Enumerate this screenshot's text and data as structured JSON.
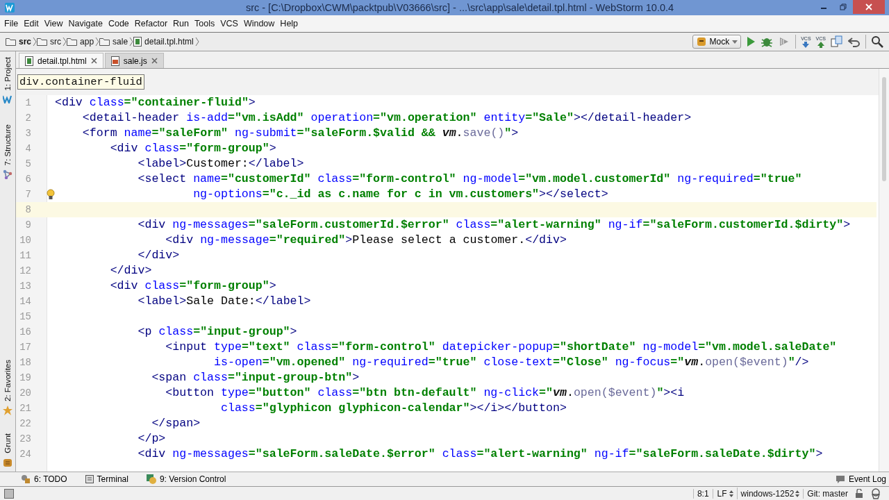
{
  "window": {
    "title": "src - [C:\\Dropbox\\CWM\\packtpub\\V03666\\src] - ...\\src\\app\\sale\\detail.tpl.html - WebStorm 10.0.4"
  },
  "menu": [
    "File",
    "Edit",
    "View",
    "Navigate",
    "Code",
    "Refactor",
    "Run",
    "Tools",
    "VCS",
    "Window",
    "Help"
  ],
  "breadcrumbs": [
    {
      "label": "src",
      "kind": "project"
    },
    {
      "label": "src",
      "kind": "folder"
    },
    {
      "label": "app",
      "kind": "folder"
    },
    {
      "label": "sale",
      "kind": "folder"
    },
    {
      "label": "detail.tpl.html",
      "kind": "file"
    }
  ],
  "toolbar": {
    "run_config": "Mock",
    "vcs_update": "VCS",
    "vcs_commit": "VCS"
  },
  "tabs": [
    {
      "label": "detail.tpl.html",
      "kind": "html",
      "selected": true
    },
    {
      "label": "sale.js",
      "kind": "js",
      "selected": false
    }
  ],
  "side_tools": {
    "top": [
      "1: Project",
      "7: Structure"
    ],
    "bottom": [
      "2: Favorites",
      "Grunt"
    ]
  },
  "editor": {
    "breadcrumb": "div.container-fluid",
    "lines": [
      {
        "number": "1",
        "current": false,
        "bulb": false,
        "tokens": [
          {
            "kind": "tag",
            "text": "<div"
          },
          {
            "kind": "attr",
            "text": " class"
          },
          {
            "kind": "value",
            "text": "=\"container-fluid\""
          },
          {
            "kind": "tag",
            "text": ">"
          }
        ]
      },
      {
        "number": "2",
        "current": false,
        "bulb": false,
        "tokens": [
          {
            "kind": "tag",
            "text": "    <detail-header"
          },
          {
            "kind": "attr",
            "text": " is-add"
          },
          {
            "kind": "value",
            "text": "=\"vm.isAdd\""
          },
          {
            "kind": "attr",
            "text": " operation"
          },
          {
            "kind": "value",
            "text": "=\"vm.operation\""
          },
          {
            "kind": "attr",
            "text": " entity"
          },
          {
            "kind": "value",
            "text": "=\"Sale\""
          },
          {
            "kind": "tag",
            "text": "></detail-header>"
          }
        ]
      },
      {
        "number": "3",
        "current": false,
        "bulb": false,
        "tokens": [
          {
            "kind": "tag",
            "text": "    <form"
          },
          {
            "kind": "attr",
            "text": " name"
          },
          {
            "kind": "value",
            "text": "=\"saleForm\""
          },
          {
            "kind": "attr",
            "text": " ng-submit"
          },
          {
            "kind": "value",
            "text": "=\"saleForm.$valid && "
          },
          {
            "kind": "variable",
            "text": "vm"
          },
          {
            "kind": "text",
            "text": "."
          },
          {
            "kind": "method",
            "text": "save()"
          },
          {
            "kind": "value",
            "text": "\""
          },
          {
            "kind": "tag",
            "text": ">"
          }
        ]
      },
      {
        "number": "4",
        "current": false,
        "bulb": false,
        "tokens": [
          {
            "kind": "tag",
            "text": "        <div"
          },
          {
            "kind": "attr",
            "text": " class"
          },
          {
            "kind": "value",
            "text": "=\"form-group\""
          },
          {
            "kind": "tag",
            "text": ">"
          }
        ]
      },
      {
        "number": "5",
        "current": false,
        "bulb": false,
        "tokens": [
          {
            "kind": "tag",
            "text": "            <label>"
          },
          {
            "kind": "text",
            "text": "Customer:"
          },
          {
            "kind": "tag",
            "text": "</label>"
          }
        ]
      },
      {
        "number": "6",
        "current": false,
        "bulb": false,
        "tokens": [
          {
            "kind": "tag",
            "text": "            <select"
          },
          {
            "kind": "attr",
            "text": " name"
          },
          {
            "kind": "value",
            "text": "=\"customerId\""
          },
          {
            "kind": "attr",
            "text": " class"
          },
          {
            "kind": "value",
            "text": "=\"form-control\""
          },
          {
            "kind": "attr",
            "text": " ng-model"
          },
          {
            "kind": "value",
            "text": "=\"vm.model.customerId\""
          },
          {
            "kind": "attr",
            "text": " ng-required"
          },
          {
            "kind": "value",
            "text": "=\"true\""
          }
        ]
      },
      {
        "number": "7",
        "current": false,
        "bulb": true,
        "tokens": [
          {
            "kind": "attr",
            "text": "                    ng-options"
          },
          {
            "kind": "value",
            "text": "=\"c._id as c.name for c in vm.customers\""
          },
          {
            "kind": "tag",
            "text": "></select>"
          }
        ]
      },
      {
        "number": "8",
        "current": true,
        "bulb": false
      },
      {
        "number": "9",
        "current": false,
        "bulb": false,
        "tokens": [
          {
            "kind": "tag",
            "text": "            <div"
          },
          {
            "kind": "attr",
            "text": " ng-messages"
          },
          {
            "kind": "value",
            "text": "=\"saleForm.customerId.$error\""
          },
          {
            "kind": "attr",
            "text": " class"
          },
          {
            "kind": "value",
            "text": "=\"alert-warning\""
          },
          {
            "kind": "attr",
            "text": " ng-if"
          },
          {
            "kind": "value",
            "text": "=\"saleForm.customerId.$dirty\""
          },
          {
            "kind": "tag",
            "text": ">"
          }
        ]
      },
      {
        "number": "10",
        "current": false,
        "bulb": false,
        "tokens": [
          {
            "kind": "tag",
            "text": "                <div"
          },
          {
            "kind": "attr",
            "text": " ng-message"
          },
          {
            "kind": "value",
            "text": "=\"required\""
          },
          {
            "kind": "tag",
            "text": ">"
          },
          {
            "kind": "text",
            "text": "Please select a customer."
          },
          {
            "kind": "tag",
            "text": "</div>"
          }
        ]
      },
      {
        "number": "11",
        "current": false,
        "bulb": false,
        "tokens": [
          {
            "kind": "tag",
            "text": "            </div>"
          }
        ]
      },
      {
        "number": "12",
        "current": false,
        "bulb": false,
        "tokens": [
          {
            "kind": "tag",
            "text": "        </div>"
          }
        ]
      },
      {
        "number": "13",
        "current": false,
        "bulb": false,
        "tokens": [
          {
            "kind": "tag",
            "text": "        <div"
          },
          {
            "kind": "attr",
            "text": " class"
          },
          {
            "kind": "value",
            "text": "=\"form-group\""
          },
          {
            "kind": "tag",
            "text": ">"
          }
        ]
      },
      {
        "number": "14",
        "current": false,
        "bulb": false,
        "tokens": [
          {
            "kind": "tag",
            "text": "            <label>"
          },
          {
            "kind": "text",
            "text": "Sale Date:"
          },
          {
            "kind": "tag",
            "text": "</label>"
          }
        ]
      },
      {
        "number": "15",
        "current": false,
        "bulb": false
      },
      {
        "number": "16",
        "current": false,
        "bulb": false,
        "tokens": [
          {
            "kind": "tag",
            "text": "            <p"
          },
          {
            "kind": "attr",
            "text": " class"
          },
          {
            "kind": "value",
            "text": "=\"input-group\""
          },
          {
            "kind": "tag",
            "text": ">"
          }
        ]
      },
      {
        "number": "17",
        "current": false,
        "bulb": false,
        "tokens": [
          {
            "kind": "tag",
            "text": "                <input"
          },
          {
            "kind": "attr",
            "text": " type"
          },
          {
            "kind": "value",
            "text": "=\"text\""
          },
          {
            "kind": "attr",
            "text": " class"
          },
          {
            "kind": "value",
            "text": "=\"form-control\""
          },
          {
            "kind": "attr",
            "text": " datepicker-popup"
          },
          {
            "kind": "value",
            "text": "=\"shortDate\""
          },
          {
            "kind": "attr",
            "text": " ng-model"
          },
          {
            "kind": "value",
            "text": "=\"vm.model.saleDate\""
          }
        ]
      },
      {
        "number": "18",
        "current": false,
        "bulb": false,
        "tokens": [
          {
            "kind": "attr",
            "text": "                       is-open"
          },
          {
            "kind": "value",
            "text": "=\"vm.opened\""
          },
          {
            "kind": "attr",
            "text": " ng-required"
          },
          {
            "kind": "value",
            "text": "=\"true\""
          },
          {
            "kind": "attr",
            "text": " close-text"
          },
          {
            "kind": "value",
            "text": "=\"Close\""
          },
          {
            "kind": "attr",
            "text": " ng-focus"
          },
          {
            "kind": "value",
            "text": "=\""
          },
          {
            "kind": "variable",
            "text": "vm"
          },
          {
            "kind": "text",
            "text": "."
          },
          {
            "kind": "method",
            "text": "open($event)"
          },
          {
            "kind": "value",
            "text": "\""
          },
          {
            "kind": "tag",
            "text": "/>"
          }
        ]
      },
      {
        "number": "19",
        "current": false,
        "bulb": false,
        "tokens": [
          {
            "kind": "tag",
            "text": "              <span"
          },
          {
            "kind": "attr",
            "text": " class"
          },
          {
            "kind": "value",
            "text": "=\"input-group-btn\""
          },
          {
            "kind": "tag",
            "text": ">"
          }
        ]
      },
      {
        "number": "20",
        "current": false,
        "bulb": false,
        "tokens": [
          {
            "kind": "tag",
            "text": "                <button"
          },
          {
            "kind": "attr",
            "text": " type"
          },
          {
            "kind": "value",
            "text": "=\"button\""
          },
          {
            "kind": "attr",
            "text": " class"
          },
          {
            "kind": "value",
            "text": "=\"btn btn-default\""
          },
          {
            "kind": "attr",
            "text": " ng-click"
          },
          {
            "kind": "value",
            "text": "=\""
          },
          {
            "kind": "variable",
            "text": "vm"
          },
          {
            "kind": "text",
            "text": "."
          },
          {
            "kind": "method",
            "text": "open($event)"
          },
          {
            "kind": "value",
            "text": "\""
          },
          {
            "kind": "tag",
            "text": "><i"
          }
        ]
      },
      {
        "number": "21",
        "current": false,
        "bulb": false,
        "tokens": [
          {
            "kind": "attr",
            "text": "                        class"
          },
          {
            "kind": "value",
            "text": "=\"glyphicon glyphicon-calendar\""
          },
          {
            "kind": "tag",
            "text": "></i></button>"
          }
        ]
      },
      {
        "number": "22",
        "current": false,
        "bulb": false,
        "tokens": [
          {
            "kind": "tag",
            "text": "              </span>"
          }
        ]
      },
      {
        "number": "23",
        "current": false,
        "bulb": false,
        "tokens": [
          {
            "kind": "tag",
            "text": "            </p>"
          }
        ]
      },
      {
        "number": "24",
        "current": false,
        "bulb": false,
        "tokens": [
          {
            "kind": "tag",
            "text": "            <div"
          },
          {
            "kind": "attr",
            "text": " ng-messages"
          },
          {
            "kind": "value",
            "text": "=\"saleForm.saleDate.$error\""
          },
          {
            "kind": "attr",
            "text": " class"
          },
          {
            "kind": "value",
            "text": "=\"alert-warning\""
          },
          {
            "kind": "attr",
            "text": " ng-if"
          },
          {
            "kind": "value",
            "text": "=\"saleForm.saleDate.$dirty\""
          },
          {
            "kind": "tag",
            "text": ">"
          }
        ]
      }
    ]
  },
  "tool_windows": [
    {
      "label": "6: TODO",
      "kind": "todo"
    },
    {
      "label": "Terminal",
      "kind": "terminal"
    },
    {
      "label": "9: Version Control",
      "kind": "vcs"
    }
  ],
  "event_log": "Event Log",
  "status_bar": {
    "position": "8:1",
    "line_separator": "LF",
    "encoding": "windows-1252",
    "branch": "Git: master"
  }
}
